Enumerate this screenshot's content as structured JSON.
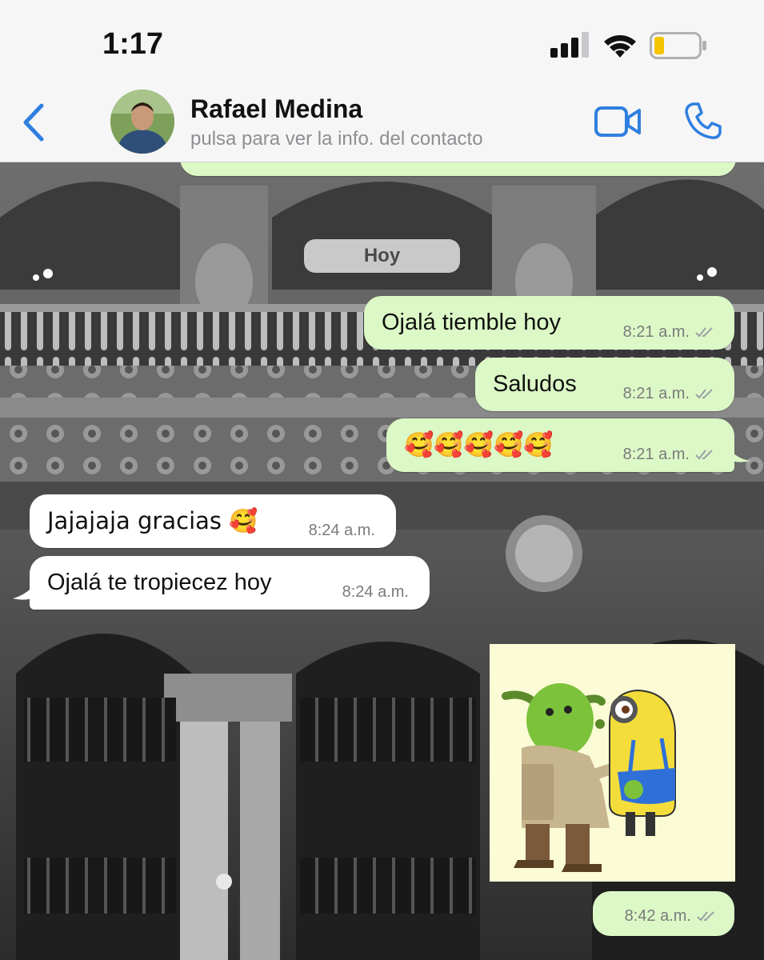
{
  "status_bar": {
    "time": "1:17"
  },
  "header": {
    "contact_name": "Rafael Medina",
    "subtitle": "pulsa para ver la info. del contacto"
  },
  "chat": {
    "date_label": "Hoy",
    "messages": [
      {
        "direction": "outgoing",
        "text": "Ojalá tiemble hoy",
        "time": "8:21 a.m."
      },
      {
        "direction": "outgoing",
        "text": "Saludos",
        "time": "8:21 a.m."
      },
      {
        "direction": "outgoing",
        "text": "🥰🥰🥰🥰🥰",
        "time": "8:21 a.m."
      },
      {
        "direction": "incoming",
        "text": "Jajajaja gracias 🥰",
        "time": "8:24 a.m."
      },
      {
        "direction": "incoming",
        "text": "Ojalá te tropiecez hoy",
        "time": "8:24 a.m."
      },
      {
        "direction": "outgoing",
        "type": "sticker",
        "caption": "",
        "time": "8:42 a.m."
      }
    ]
  },
  "colors": {
    "accent": "#2f7fe0",
    "outgoing_bubble": "#dcf8c6",
    "incoming_bubble": "#ffffff",
    "read_ticks": "#9aa0a6"
  },
  "icons": {
    "back": "chevron-left-icon",
    "video": "video-camera-icon",
    "call": "phone-icon",
    "signal": "cellular-signal-icon",
    "wifi": "wifi-icon",
    "battery": "battery-low-icon"
  }
}
